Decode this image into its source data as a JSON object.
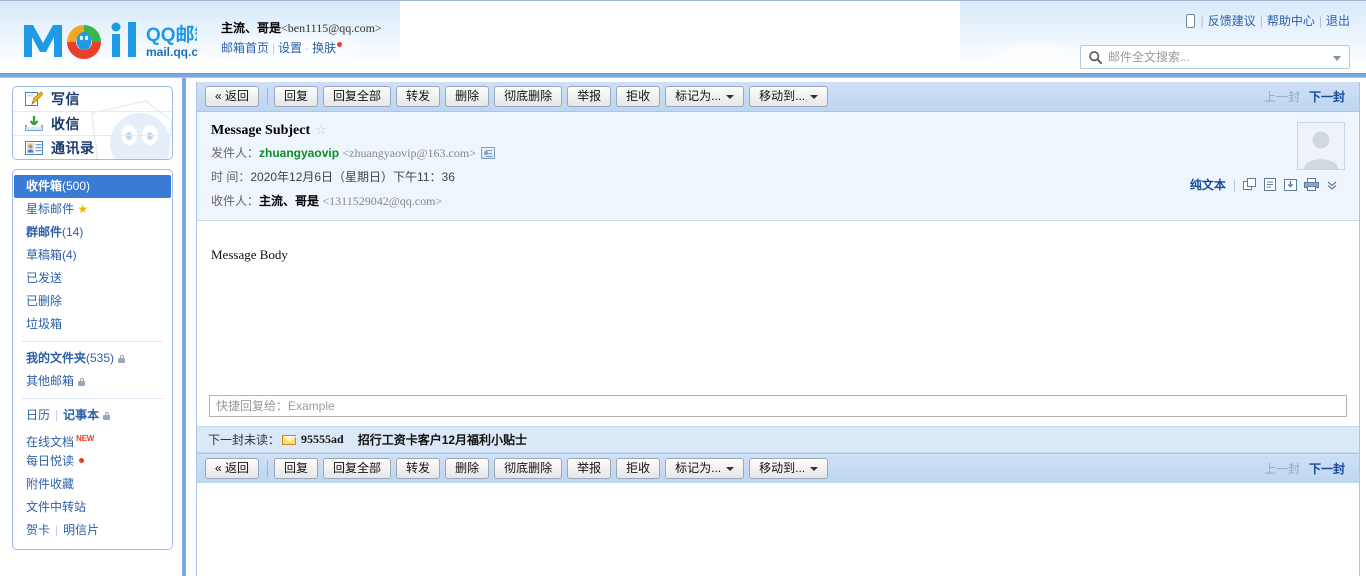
{
  "header": {
    "logo_main": "Mail",
    "logo_cn": "QQ邮箱",
    "logo_domain": "mail.qq.com",
    "account_name": "主流、哥是",
    "account_address": "<ben1115@qq.com>",
    "links": [
      {
        "label": "邮箱首页",
        "name": "mail-home-link"
      },
      {
        "label": "设置",
        "name": "settings-link"
      },
      {
        "label": "换肤",
        "name": "skin-link"
      }
    ],
    "top_links": [
      {
        "label": "反馈建议",
        "name": "feedback-link"
      },
      {
        "label": "帮助中心",
        "name": "help-center-link"
      },
      {
        "label": "退出",
        "name": "logout-link"
      }
    ],
    "phone_icon": "mobile-phone-icon",
    "search": {
      "placeholder": "邮件全文搜索...",
      "value": "",
      "icon": "search-icon",
      "caret_icon": "chevron-down-icon"
    }
  },
  "sidebar": {
    "actions": [
      {
        "label": "写信",
        "icon": "compose-icon"
      },
      {
        "label": "收信",
        "icon": "receive-icon"
      },
      {
        "label": "通讯录",
        "icon": "contacts-icon"
      }
    ],
    "folders": [
      {
        "label": "收件箱",
        "count": "(500)",
        "selected": true,
        "bold": true
      },
      {
        "label": "星标邮件",
        "count": "",
        "star": true
      },
      {
        "label": "群邮件",
        "count": "(14)",
        "bold": true
      },
      {
        "label": "草稿箱",
        "count": "(4)"
      },
      {
        "label": "已发送",
        "count": ""
      },
      {
        "label": "已删除",
        "count": ""
      },
      {
        "label": "垃圾箱",
        "count": ""
      }
    ],
    "folders2": [
      {
        "label": "我的文件夹",
        "count": "(535)",
        "bold": true,
        "lock": true
      },
      {
        "label": "其他邮箱",
        "count": "",
        "lock": true
      }
    ],
    "tools_row": [
      {
        "label": "日历"
      },
      {
        "label": "记事本",
        "lock": true
      }
    ],
    "extras": [
      {
        "label": "在线文档",
        "badge": "NEW"
      },
      {
        "label": "每日悦读",
        "dot": true
      },
      {
        "label": "附件收藏"
      },
      {
        "label": "文件中转站"
      }
    ],
    "cards_row": [
      {
        "label": "贺卡"
      },
      {
        "label": "明信片"
      }
    ]
  },
  "toolbar": {
    "back_label": "« 返回",
    "buttons": [
      {
        "label": "回复",
        "name": "reply-button"
      },
      {
        "label": "回复全部",
        "name": "reply-all-button"
      },
      {
        "label": "转发",
        "name": "forward-button"
      },
      {
        "label": "删除",
        "name": "delete-button"
      },
      {
        "label": "彻底删除",
        "name": "delete-permanently-button"
      },
      {
        "label": "举报",
        "name": "report-button"
      },
      {
        "label": "拒收",
        "name": "reject-button"
      }
    ],
    "dropdowns": [
      {
        "label": "标记为...",
        "name": "mark-as-dropdown"
      },
      {
        "label": "移动到...",
        "name": "move-to-dropdown"
      }
    ],
    "prev_label": "上一封",
    "next_label": "下一封"
  },
  "message": {
    "subject": "Message Subject",
    "star_icon": "star-outline-icon",
    "from_label": "发件人：",
    "from_name": "zhuangyaovip",
    "from_address": "<zhuangyaovip@163.com>",
    "contact_card_icon": "contact-card-icon",
    "time_label": "时  间：",
    "time_value": "2020年12月6日（星期日）下午11：36",
    "to_label": "收件人：",
    "to_name": "主流、哥是",
    "to_address": "<1311529042@qq.com>",
    "avatar_icon": "avatar-placeholder",
    "view_mode": "纯文本",
    "view_icons": [
      {
        "name": "open-in-new-window-icon"
      },
      {
        "name": "save-as-note-icon"
      },
      {
        "name": "download-icon"
      },
      {
        "name": "print-icon"
      },
      {
        "name": "chevron-double-down-icon"
      }
    ],
    "body": "Message Body"
  },
  "quick_reply": {
    "placeholder": "快捷回复给：Example",
    "value": ""
  },
  "next_unread": {
    "label": "下一封未读：",
    "envelope_icon": "envelope-icon",
    "sender": "95555ad",
    "subject": "招行工资卡客户12月福利小贴士"
  },
  "colors": {
    "accent_blue": "#3a7bd5",
    "link_blue": "#2c5fa8",
    "bar_blue": "#7ba7e0",
    "toolbar_blue": "#c5dbf3",
    "header_panel": "#eef5fc",
    "from_green": "#0a8f2a",
    "star_gold": "#f5b300",
    "new_red": "#e8412b"
  }
}
